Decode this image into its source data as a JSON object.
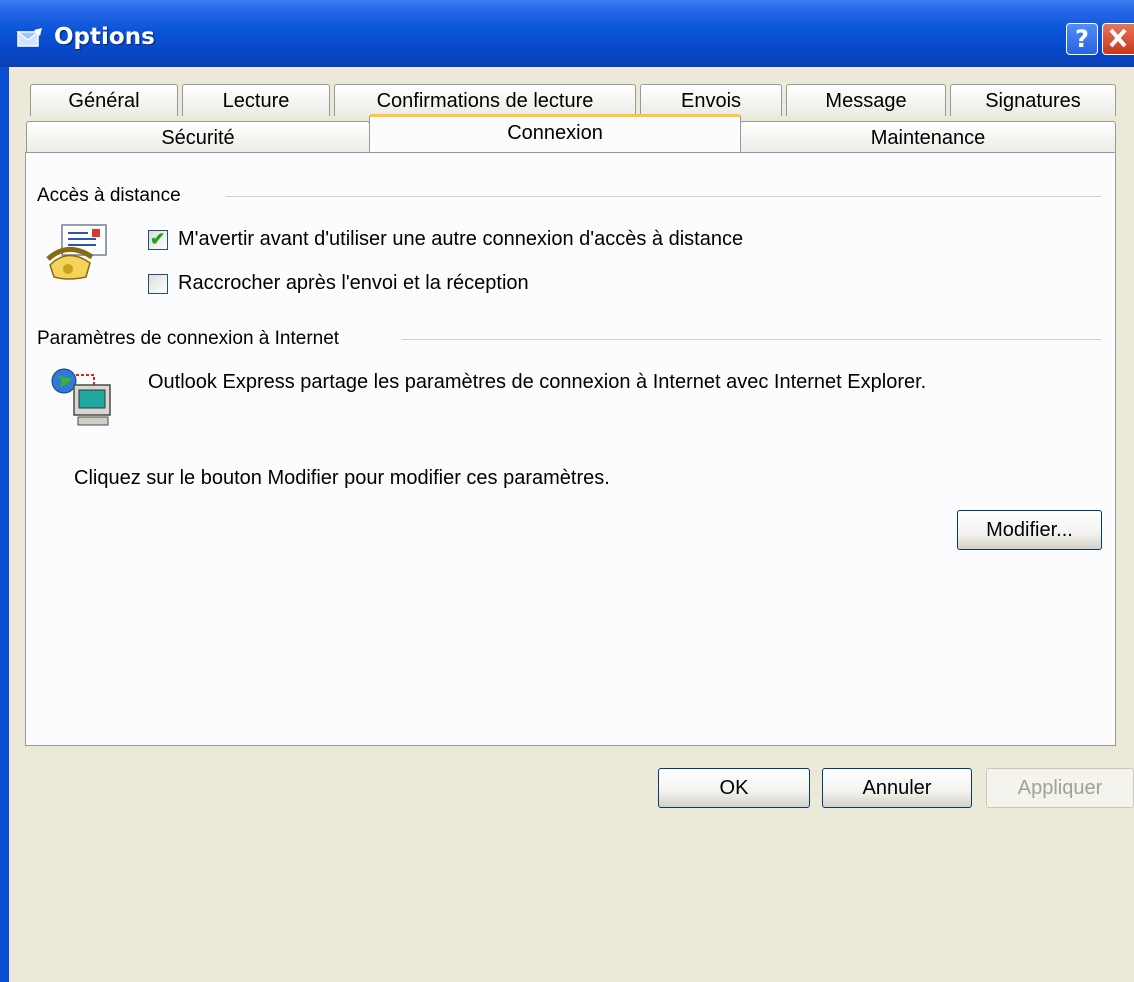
{
  "window": {
    "title": "Options",
    "help_label": "?"
  },
  "tabs_top": [
    "Général",
    "Lecture",
    "Confirmations de lecture",
    "Envois",
    "Message",
    "Signatures"
  ],
  "tabs_bottom": [
    "Sécurité",
    "Connexion",
    "Maintenance"
  ],
  "active_tab": "Connexion",
  "dialup": {
    "header": "Accès à distance",
    "option_warn": {
      "label": "M'avertir avant d'utiliser une autre connexion d'accès à distance",
      "checked": true
    },
    "option_hangup": {
      "label": "Raccrocher après l'envoi et la réception",
      "checked": false
    }
  },
  "internet": {
    "header": "Paramètres de connexion à Internet",
    "info": "Outlook Express partage les paramètres de connexion à Internet avec Internet Explorer.",
    "instruction": "Cliquez sur le bouton Modifier pour modifier ces paramètres.",
    "modify_label": "Modifier..."
  },
  "footer": {
    "ok_label": "OK",
    "cancel_label": "Annuler",
    "apply_label": "Appliquer"
  },
  "colors": {
    "titlebar": "#0a55d8",
    "active_tab_accent": "#ffc83c",
    "check": "#21a121"
  },
  "icons": [
    "options-app-icon",
    "help-icon",
    "close-icon",
    "dialup-phone-icon",
    "network-computer-icon",
    "checkmark-icon"
  ]
}
